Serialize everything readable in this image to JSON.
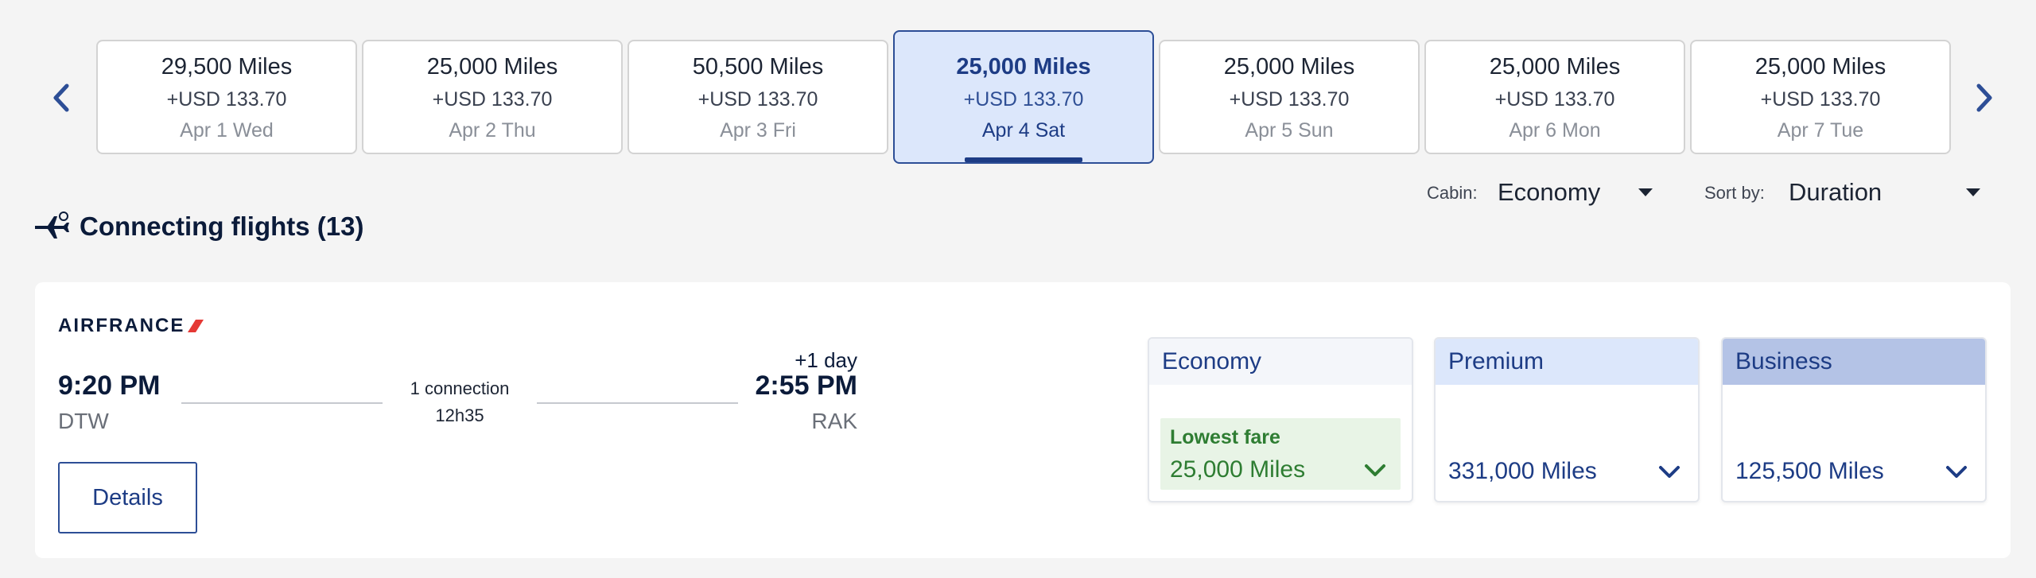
{
  "date_strip": {
    "cards": [
      {
        "miles": "29,500 Miles",
        "usd": "+USD 133.70",
        "date": "Apr 1 Wed"
      },
      {
        "miles": "25,000 Miles",
        "usd": "+USD 133.70",
        "date": "Apr 2 Thu"
      },
      {
        "miles": "50,500 Miles",
        "usd": "+USD 133.70",
        "date": "Apr 3 Fri"
      },
      {
        "miles": "25,000 Miles",
        "usd": "+USD 133.70",
        "date": "Apr 4 Sat"
      },
      {
        "miles": "25,000 Miles",
        "usd": "+USD 133.70",
        "date": "Apr 5 Sun"
      },
      {
        "miles": "25,000 Miles",
        "usd": "+USD 133.70",
        "date": "Apr 6 Mon"
      },
      {
        "miles": "25,000 Miles",
        "usd": "+USD 133.70",
        "date": "Apr 7 Tue"
      }
    ],
    "selected_index": 3,
    "prev_icon": "chevron-left-icon",
    "next_icon": "chevron-right-icon"
  },
  "filters": {
    "cabin_label": "Cabin:",
    "cabin_value": "Economy",
    "sort_label": "Sort by:",
    "sort_value": "Duration"
  },
  "section": {
    "icon": "connecting-flight-icon",
    "title": "Connecting flights (13)"
  },
  "flight": {
    "airline": "AIRFRANCE",
    "departure_time": "9:20 PM",
    "departure_airport": "DTW",
    "arrival_day_offset": "+1 day",
    "arrival_time": "2:55 PM",
    "arrival_airport": "RAK",
    "connections": "1 connection",
    "duration": "12h35",
    "details_label": "Details",
    "fares": {
      "economy": {
        "label": "Economy",
        "badge": "Lowest fare",
        "price": "25,000 Miles"
      },
      "premium": {
        "label": "Premium",
        "price": "331,000 Miles"
      },
      "business": {
        "label": "Business",
        "price": "125,500 Miles"
      }
    }
  },
  "colors": {
    "brand_blue": "#1d3c85",
    "selected_bg": "#dce7fb",
    "lowest_fare_green": "#2e7d32",
    "premium_header": "#dce7fb",
    "business_header": "#b4c3e6",
    "economy_header": "#f4f6fa",
    "airfrance_red": "#e53935"
  }
}
